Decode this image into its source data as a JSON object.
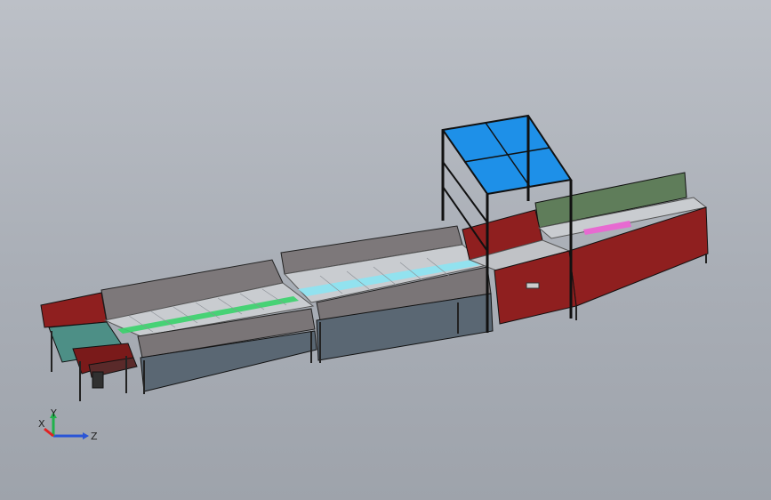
{
  "viewport": {
    "background_top": "#bcc0c7",
    "background_bottom": "#9ea3ab"
  },
  "model": {
    "frame_color": "#1c1c1c",
    "roof_color": "#1e90e8",
    "red_color": "#8f1f1f",
    "green_color": "#5f7d5a",
    "conveyor_gray": "#c9ccd0",
    "bed_blue_gray": "#5a6773",
    "accent_green": "#39d36a",
    "accent_cyan": "#8fe3f0",
    "accent_pink": "#e76ad1"
  },
  "triad": {
    "x_label": "X",
    "y_label": "Y",
    "z_label": "Z",
    "x_color": "#e12222",
    "y_color": "#21b24b",
    "z_color": "#2a55d6"
  }
}
